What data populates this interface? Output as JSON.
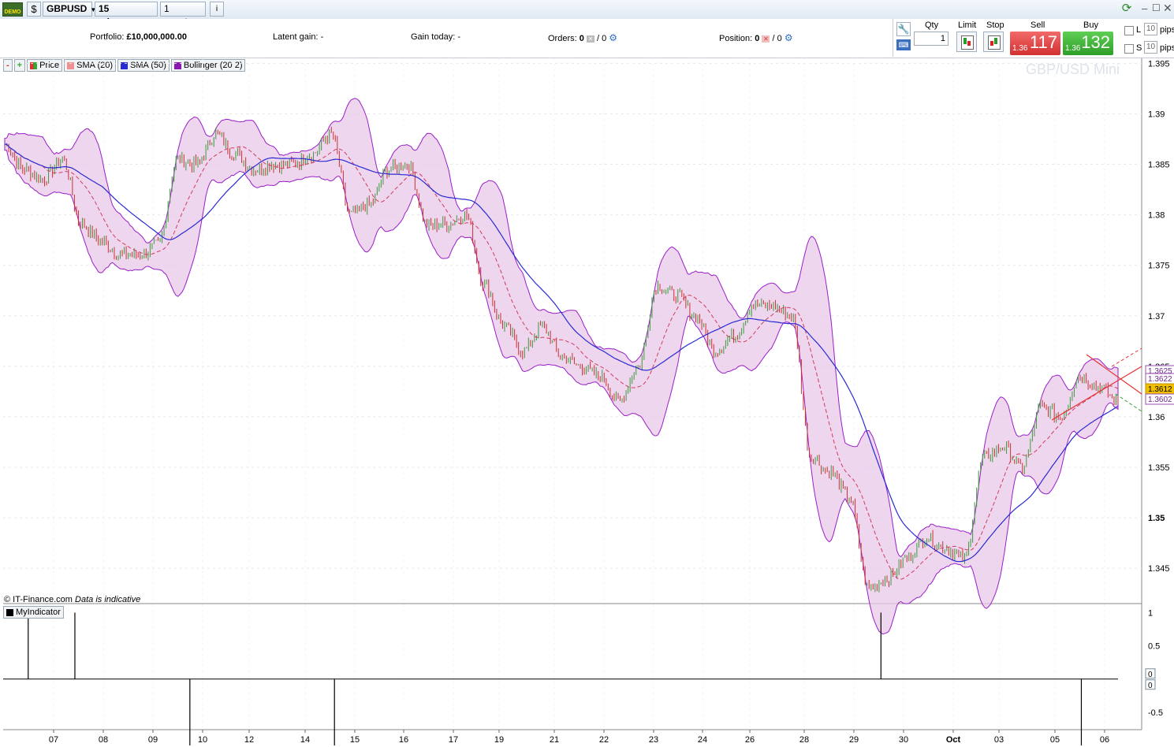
{
  "toolbar": {
    "symbol": "GBPUSD",
    "timeframe": "15 minutes",
    "period": "1 month",
    "info_icon": "info-icon",
    "demo_badge": "DEMO"
  },
  "infobar": {
    "portfolio_label": "Portfolio:",
    "portfolio_value": "£10,000,000.00",
    "latent_label": "Latent gain:",
    "latent_value": "-",
    "gain_today_label": "Gain today:",
    "gain_today_value": "-",
    "orders_label": "Orders:",
    "orders_value": "0",
    "orders_value2": "/ 0",
    "position_label": "Position:",
    "position_value": "0",
    "position_value2": "/ 0"
  },
  "trade": {
    "qty_label": "Qty",
    "qty_value": "1",
    "limit_label": "Limit",
    "stop_label": "Stop",
    "sell_label": "Sell",
    "sell_small": "1.36",
    "sell_big": "117",
    "buy_label": "Buy",
    "buy_small": "1.36",
    "buy_big": "132",
    "l_label": "L",
    "s_label": "S",
    "l_pips": "10",
    "s_pips": "10",
    "pips_label": "pips"
  },
  "legend": {
    "price": "Price",
    "sma20": "SMA (20)",
    "sma50": "SMA (50)",
    "bollinger": "Bollinger (20 2)"
  },
  "watermark": "GBP/USD Mini",
  "copyright": "© IT-Finance.com",
  "indicative": "Data is indicative",
  "indicator_label": "MyIndicator",
  "colors": {
    "band_fill": "#e8c8e8",
    "band_line": "#9a1ec8",
    "sma20": "#d23c5a",
    "sma50": "#2a2ad2",
    "up_candle": "#3c9a3c",
    "down_candle": "#c83232",
    "current_price_bg": "#f0c000"
  },
  "chart_data": {
    "type": "line",
    "title": "",
    "ylim": [
      1.3415,
      1.3955
    ],
    "y_ticks": [
      "1.395",
      "1.39",
      "1.385",
      "1.38",
      "1.375",
      "1.37",
      "1.365",
      "1.36",
      "1.355",
      "1.35",
      "1.345"
    ],
    "x_ticks": [
      "07",
      "08",
      "09",
      "10",
      "12",
      "14",
      "15",
      "16",
      "17",
      "19",
      "21",
      "22",
      "23",
      "24",
      "26",
      "28",
      "29",
      "30",
      "Oct",
      "03",
      "05",
      "06"
    ],
    "price_labels": [
      "1.3625",
      "1.3622",
      "1.3612",
      "1.3602"
    ],
    "series": [
      {
        "name": "Price",
        "values": [
          1.387,
          1.3845,
          1.3835,
          1.3855,
          1.379,
          1.3775,
          1.376,
          1.376,
          1.377,
          1.3855,
          1.385,
          1.388,
          1.386,
          1.3845,
          1.385,
          1.385,
          1.386,
          1.388,
          1.38,
          1.381,
          1.3845,
          1.385,
          1.379,
          1.379,
          1.38,
          1.373,
          1.369,
          1.3665,
          1.369,
          1.366,
          1.365,
          1.364,
          1.3615,
          1.365,
          1.373,
          1.372,
          1.37,
          1.3665,
          1.368,
          1.371,
          1.371,
          1.37,
          1.356,
          1.3545,
          1.352,
          1.343,
          1.344,
          1.346,
          1.348,
          1.347,
          1.346,
          1.356,
          1.357,
          1.355,
          1.361,
          1.36,
          1.364,
          1.363,
          1.3615
        ]
      }
    ]
  },
  "indicator_data": {
    "type": "bar",
    "ylim": [
      -0.75,
      1.1
    ],
    "y_ticks": [
      "1",
      "0.5",
      "0",
      "-0.5"
    ],
    "value_boxes": [
      "0",
      "0"
    ],
    "spikes": [
      {
        "pos": 0.022,
        "value": 1
      },
      {
        "pos": 0.063,
        "value": 1
      },
      {
        "pos": 0.164,
        "value": -1
      },
      {
        "pos": 0.291,
        "value": -1
      },
      {
        "pos": 0.771,
        "value": 1
      },
      {
        "pos": 0.947,
        "value": -1
      }
    ]
  }
}
